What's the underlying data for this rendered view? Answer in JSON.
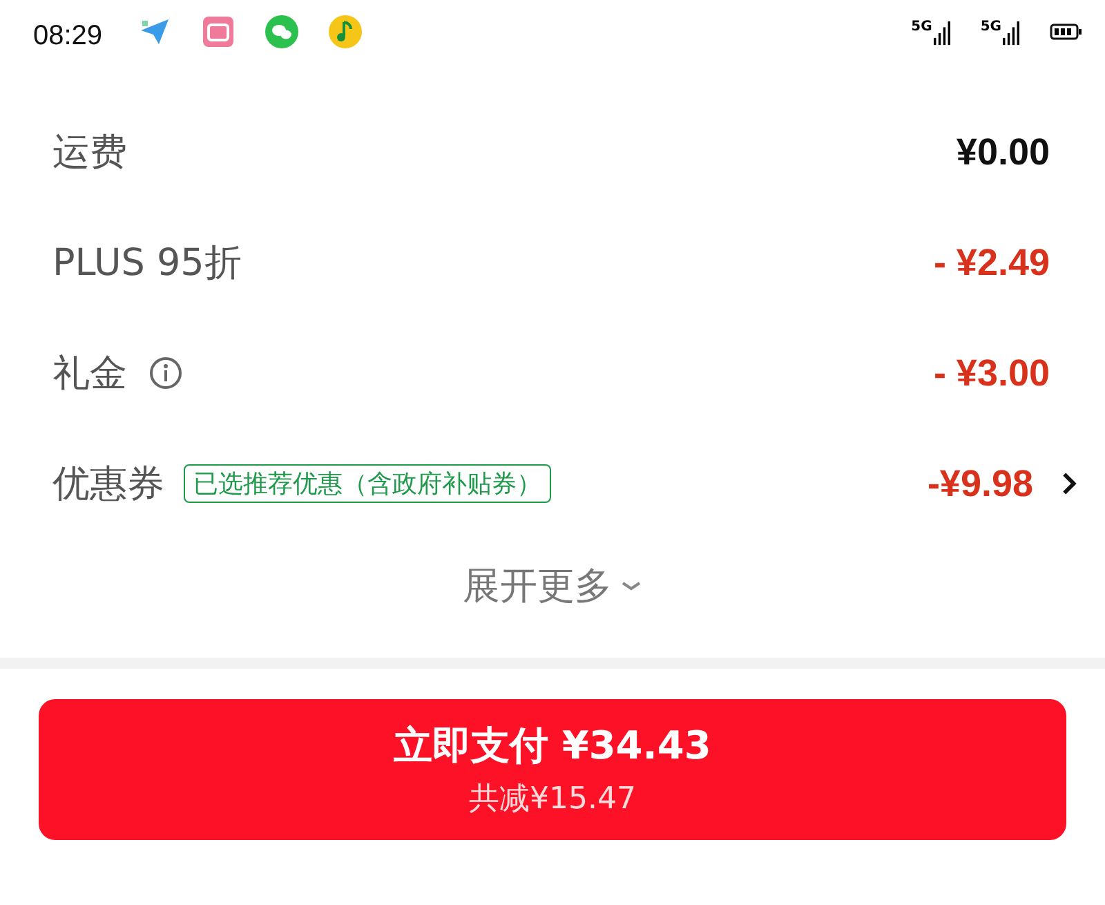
{
  "status_bar": {
    "time": "08:29",
    "networks": [
      "5G",
      "5G"
    ]
  },
  "rows": [
    {
      "label": "运费",
      "kind": "plain",
      "amount": "¥0.00",
      "info": false,
      "chevron": false
    },
    {
      "label": "PLUS 95折",
      "kind": "discount",
      "amount": "- ¥2.49",
      "info": false,
      "chevron": false
    },
    {
      "label": "礼金",
      "kind": "discount",
      "amount": "- ¥3.00",
      "info": true,
      "chevron": false
    },
    {
      "label": "优惠券",
      "kind": "discount",
      "tag": "已选推荐优惠（含政府补贴券）",
      "amount": "-¥9.98",
      "info": false,
      "chevron": true
    }
  ],
  "expand": {
    "label": "展开更多"
  },
  "pay_button": {
    "label": "立即支付 ¥34.43",
    "subtitle": "共减¥15.47"
  }
}
